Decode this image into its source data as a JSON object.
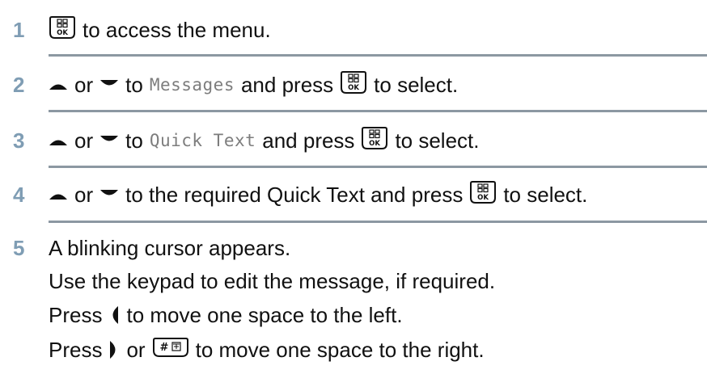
{
  "steps": [
    {
      "number": "1",
      "text": {
        "a": "to access the menu."
      },
      "icons": [
        "menu-ok-key-icon"
      ]
    },
    {
      "number": "2",
      "text": {
        "or": "or",
        "to": "to",
        "menu_item": "Messages",
        "and_press": "and press",
        "to_select": "to select."
      },
      "icons": [
        "up-arrow-icon",
        "down-arrow-icon",
        "menu-ok-key-icon"
      ]
    },
    {
      "number": "3",
      "text": {
        "or": "or",
        "to": "to",
        "menu_item": "Quick Text",
        "and_press": "and press",
        "to_select": "to select."
      },
      "icons": [
        "up-arrow-icon",
        "down-arrow-icon",
        "menu-ok-key-icon"
      ]
    },
    {
      "number": "4",
      "text": {
        "or": "or",
        "rest": "to the required Quick Text and press",
        "to_select": "to select."
      },
      "icons": [
        "up-arrow-icon",
        "down-arrow-icon",
        "menu-ok-key-icon"
      ]
    },
    {
      "number": "5",
      "lines": {
        "l1": "A blinking cursor appears.",
        "l2": "Use the keypad to edit the message, if required.",
        "l3_press": "Press",
        "l3_rest": "to move one space to the left.",
        "l4_press": "Press",
        "l4_or": "or",
        "l4_rest": "to move one space to the right."
      },
      "icons": [
        "left-arrow-icon",
        "right-arrow-icon",
        "hash-key-icon"
      ]
    }
  ],
  "key_labels": {
    "ok": "OK",
    "hash": "#"
  },
  "colors": {
    "step_number": "#7f9db4",
    "separator": "#8c98a2",
    "mono_text": "#7d7d7d"
  }
}
